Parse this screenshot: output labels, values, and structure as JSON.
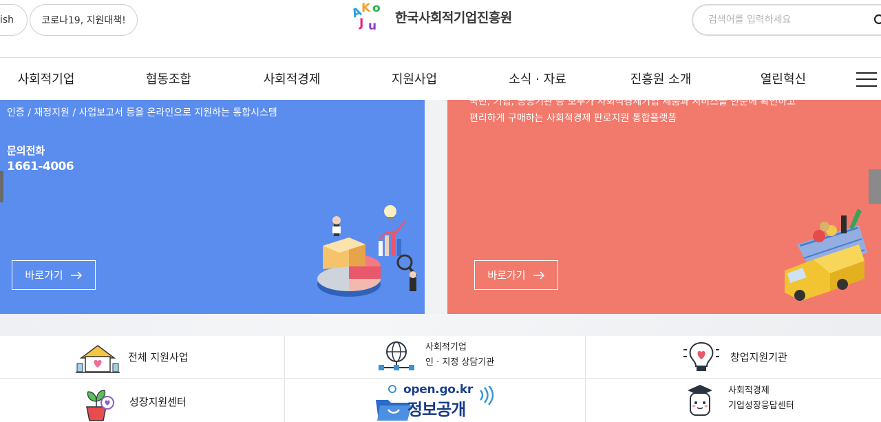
{
  "header": {
    "lang_button": "lish",
    "corona_button": "코로나19, 지원대책!",
    "logo_text": "한국사회적기업진흥원",
    "search_placeholder": "검색어를 입력하세요"
  },
  "gnb": {
    "items": [
      "사회적기업",
      "협동조합",
      "사회적경제",
      "지원사업",
      "소식 · 자료",
      "진흥원 소개",
      "열린혁신"
    ]
  },
  "banners": [
    {
      "desc_lines": [
        "인증 / 재정지원 / 사업보고서 등을 온라인으로 지원하는 통합시스템"
      ],
      "phone_label": "문의전화",
      "phone": "1661-4006",
      "button": "바로가기",
      "color": "#5b8def"
    },
    {
      "desc_lines": [
        "국민, 기업, 공공기관 등 모두가 사회적경제기업 제품과 서비스를 한눈에 확인하고",
        "편리하게 구매하는 사회적경제 판로지원 통합플랫폼"
      ],
      "button": "바로가기",
      "color": "#f17a6d"
    }
  ],
  "quick_menu": [
    {
      "label": "전체 지원사업",
      "icon": "house-heart-icon"
    },
    {
      "label_lines": [
        "사회적기업",
        "인 · 지정 상담기관"
      ],
      "icon": "globe-network-icon"
    },
    {
      "label": "창업지원기관",
      "icon": "lightbulb-heart-icon"
    },
    {
      "label": "성장지원센터",
      "icon": "plant-pot-icon"
    },
    {
      "open_small": "open.go.kr",
      "open_big": "정보공개",
      "icon": "folder-signal-icon"
    },
    {
      "label_lines": [
        "사회적경제",
        "기업성장응답센터"
      ],
      "icon": "graduate-character-icon"
    }
  ]
}
